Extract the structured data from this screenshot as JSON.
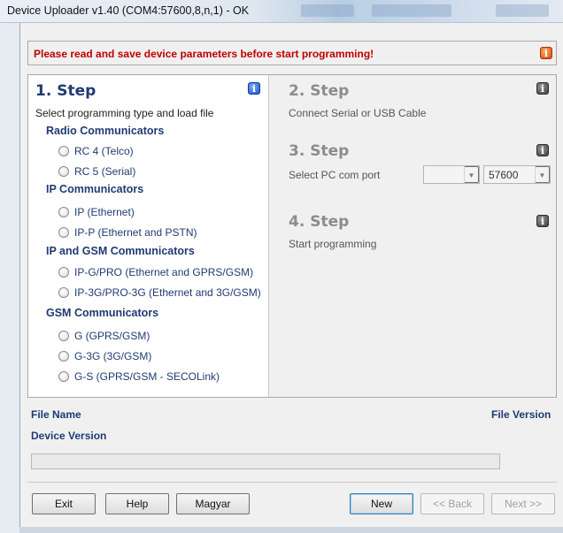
{
  "window": {
    "title": "Device Uploader v1.40 (COM4:57600,8,n,1) - OK"
  },
  "banner": {
    "message": "Please read and save device parameters before start programming!"
  },
  "step1": {
    "title": "1. Step",
    "description": "Select programming type and load file",
    "groups": [
      {
        "heading": "Radio Communicators",
        "options": [
          "RC 4 (Telco)",
          "RC 5 (Serial)"
        ]
      },
      {
        "heading": "IP Communicators",
        "options": [
          "IP (Ethernet)",
          "IP-P (Ethernet and PSTN)"
        ]
      },
      {
        "heading": "IP and GSM Communicators",
        "options": [
          "IP-G/PRO (Ethernet and GPRS/GSM)",
          "IP-3G/PRO-3G (Ethernet and 3G/GSM)"
        ]
      },
      {
        "heading": "GSM Communicators",
        "options": [
          "G (GPRS/GSM)",
          "G-3G (3G/GSM)",
          "G-S (GPRS/GSM - SECOLink)"
        ]
      }
    ]
  },
  "step2": {
    "title": "2. Step",
    "description": "Connect Serial or USB Cable"
  },
  "step3": {
    "title": "3. Step",
    "description": "Select PC com port",
    "port_value": "",
    "baud_value": "57600"
  },
  "step4": {
    "title": "4. Step",
    "description": "Start programming"
  },
  "file_info": {
    "file_name_label": "File Name",
    "file_version_label": "File Version",
    "device_version_label": "Device Version",
    "progress": 0
  },
  "buttons": {
    "exit": "Exit",
    "help": "Help",
    "language": "Magyar",
    "new": "New",
    "back": "<< Back",
    "next": "Next >>"
  },
  "colors": {
    "warning": "#c00000",
    "heading": "#1f3b73",
    "inactive_step": "#8c8c8c"
  }
}
